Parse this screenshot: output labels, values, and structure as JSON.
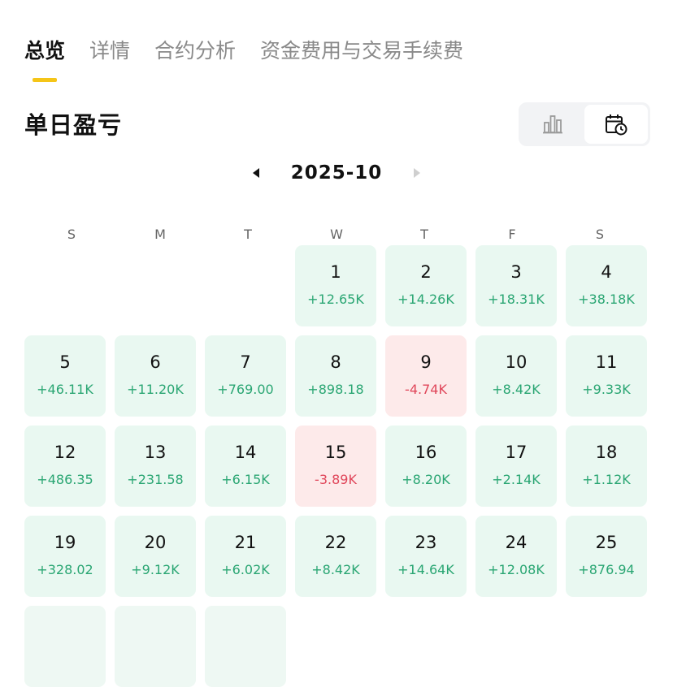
{
  "tabs": [
    {
      "label": "总览",
      "active": true
    },
    {
      "label": "详情",
      "active": false
    },
    {
      "label": "合约分析",
      "active": false
    },
    {
      "label": "资金费用与交易手续费",
      "active": false
    }
  ],
  "section": {
    "title": "单日盈亏"
  },
  "view_toggle": {
    "options": [
      {
        "icon": "bar-chart-icon",
        "active": false
      },
      {
        "icon": "calendar-clock-icon",
        "active": true
      }
    ]
  },
  "month_nav": {
    "label": "2025-10",
    "prev_icon": "triangle-left-icon",
    "next_icon": "triangle-right-icon",
    "next_enabled": false
  },
  "weekdays": [
    "S",
    "M",
    "T",
    "W",
    "T",
    "F",
    "S"
  ],
  "colors": {
    "accent": "#f5c518",
    "profit_text": "#2aa673",
    "profit_bg": "#e9f8f1",
    "loss_text": "#e0465a",
    "loss_bg": "#fdeaea"
  },
  "calendar": {
    "first_weekday_index": 3,
    "days": [
      {
        "day": "1",
        "pnl": "+12.65K",
        "type": "profit"
      },
      {
        "day": "2",
        "pnl": "+14.26K",
        "type": "profit"
      },
      {
        "day": "3",
        "pnl": "+18.31K",
        "type": "profit"
      },
      {
        "day": "4",
        "pnl": "+38.18K",
        "type": "profit"
      },
      {
        "day": "5",
        "pnl": "+46.11K",
        "type": "profit"
      },
      {
        "day": "6",
        "pnl": "+11.20K",
        "type": "profit"
      },
      {
        "day": "7",
        "pnl": "+769.00",
        "type": "profit"
      },
      {
        "day": "8",
        "pnl": "+898.18",
        "type": "profit"
      },
      {
        "day": "9",
        "pnl": "-4.74K",
        "type": "loss"
      },
      {
        "day": "10",
        "pnl": "+8.42K",
        "type": "profit"
      },
      {
        "day": "11",
        "pnl": "+9.33K",
        "type": "profit"
      },
      {
        "day": "12",
        "pnl": "+486.35",
        "type": "profit"
      },
      {
        "day": "13",
        "pnl": "+231.58",
        "type": "profit"
      },
      {
        "day": "14",
        "pnl": "+6.15K",
        "type": "profit"
      },
      {
        "day": "15",
        "pnl": "-3.89K",
        "type": "loss"
      },
      {
        "day": "16",
        "pnl": "+8.20K",
        "type": "profit"
      },
      {
        "day": "17",
        "pnl": "+2.14K",
        "type": "profit"
      },
      {
        "day": "18",
        "pnl": "+1.12K",
        "type": "profit"
      },
      {
        "day": "19",
        "pnl": "+328.02",
        "type": "profit"
      },
      {
        "day": "20",
        "pnl": "+9.12K",
        "type": "profit"
      },
      {
        "day": "21",
        "pnl": "+6.02K",
        "type": "profit"
      },
      {
        "day": "22",
        "pnl": "+8.42K",
        "type": "profit"
      },
      {
        "day": "23",
        "pnl": "+14.64K",
        "type": "profit"
      },
      {
        "day": "24",
        "pnl": "+12.08K",
        "type": "profit"
      },
      {
        "day": "25",
        "pnl": "+876.94",
        "type": "profit"
      },
      {
        "day": "",
        "pnl": "",
        "type": "blank"
      },
      {
        "day": "",
        "pnl": "",
        "type": "blank"
      },
      {
        "day": "",
        "pnl": "",
        "type": "blank"
      }
    ]
  }
}
